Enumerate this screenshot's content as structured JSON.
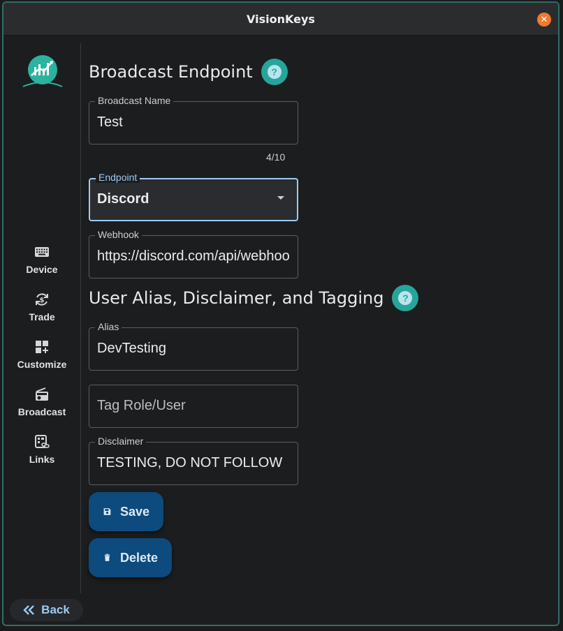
{
  "window": {
    "title": "VisionKeys"
  },
  "sidebar": {
    "items": [
      {
        "label": "Device",
        "icon": "keyboard-icon"
      },
      {
        "label": "Trade",
        "icon": "dollar-sync-icon"
      },
      {
        "label": "Customize",
        "icon": "dashboard-add-icon"
      },
      {
        "label": "Broadcast",
        "icon": "radio-icon"
      },
      {
        "label": "Links",
        "icon": "link-card-icon"
      }
    ],
    "back_label": "Back"
  },
  "broadcast_section": {
    "title": "Broadcast Endpoint",
    "name_label": "Broadcast Name",
    "name_value": "Test",
    "name_counter": "4/10",
    "endpoint_label": "Endpoint",
    "endpoint_value": "Discord",
    "webhook_label": "Webhook",
    "webhook_value": "https://discord.com/api/webhooks/"
  },
  "alias_section": {
    "title": "User Alias, Disclaimer, and Tagging",
    "alias_label": "Alias",
    "alias_value": "DevTesting",
    "tag_placeholder": "Tag Role/User",
    "disclaimer_label": "Disclaimer",
    "disclaimer_value": "TESTING, DO NOT FOLLOW"
  },
  "actions": {
    "save_label": "Save",
    "delete_label": "Delete"
  },
  "colors": {
    "accent_teal": "#26a69a",
    "focus_blue": "#9ecbf3",
    "button_blue": "#0d4a7d",
    "close_orange": "#f07a2c"
  }
}
